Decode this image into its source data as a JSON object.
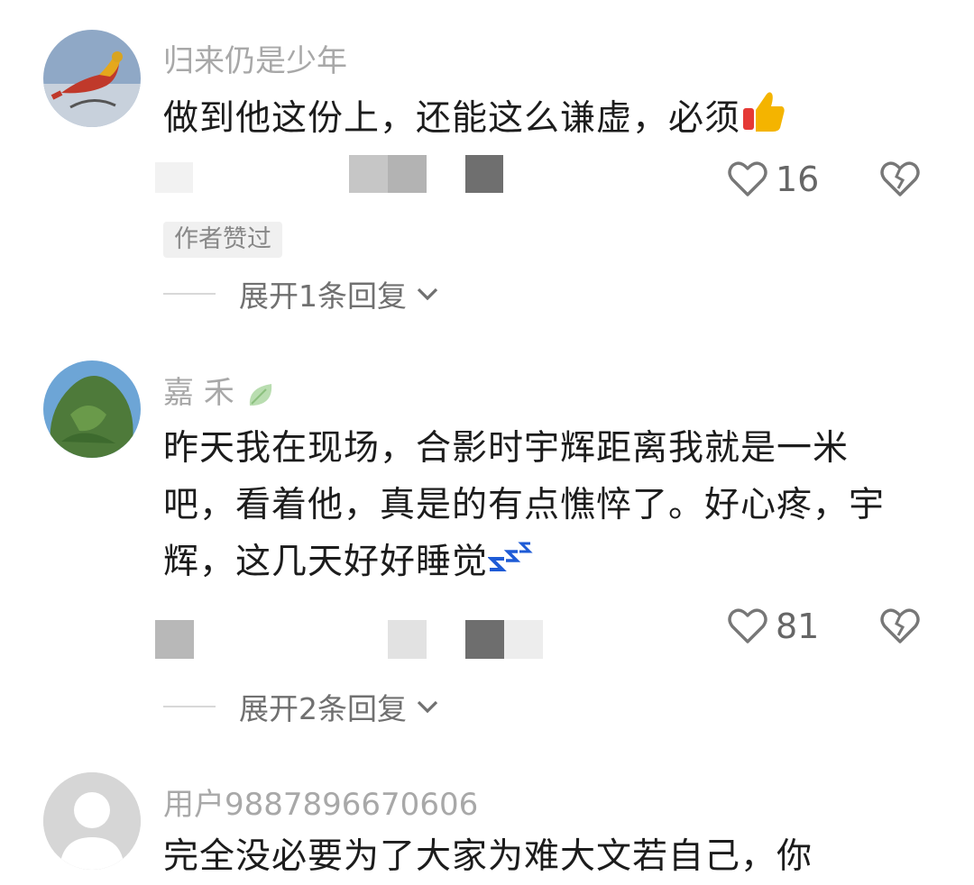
{
  "comments": [
    {
      "username": "归来仍是少年",
      "text": "做到他这份上，还能这么谦虚，必须",
      "emoji": "thumbs-up-icon",
      "likes": "16",
      "author_tag": "作者赞过",
      "expand_label": "展开1条回复"
    },
    {
      "username": "嘉 禾",
      "username_icon": "leaf-icon",
      "text": "昨天我在现场，合影时宇辉距离我就是一米吧，看着他，真是的有点憔悴了。好心疼，宇辉，这几天好好睡觉",
      "emoji": "sleeping-zzz-icon",
      "likes": "81",
      "expand_label": "展开2条回复"
    },
    {
      "username": "用户9887896670606",
      "text": "完全没必要为了大家为难大文若自己，你"
    }
  ],
  "colors": {
    "username": "#a8a8a8",
    "text": "#1c1c1c",
    "secondary": "#707070",
    "tag_bg": "#f0f0f0"
  }
}
